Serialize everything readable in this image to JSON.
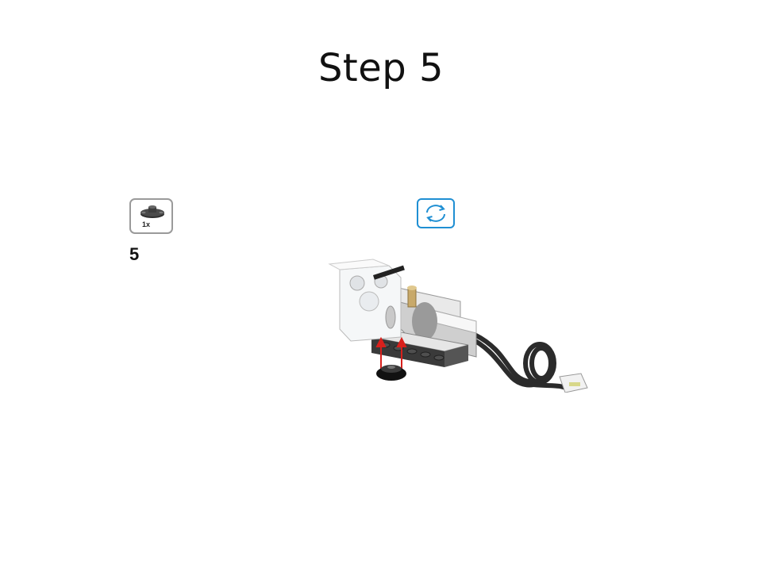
{
  "slide": {
    "title": "Step 5"
  },
  "parts_callout": {
    "quantity": "1x",
    "part_icon": "round-plate-icon"
  },
  "step": {
    "number": "5"
  },
  "rotate": {
    "icon": "rotate-icon",
    "accent": "#1f8fd3"
  },
  "model": {
    "arrow_color": "#d8201c",
    "cable_color": "#2b2b2b"
  }
}
